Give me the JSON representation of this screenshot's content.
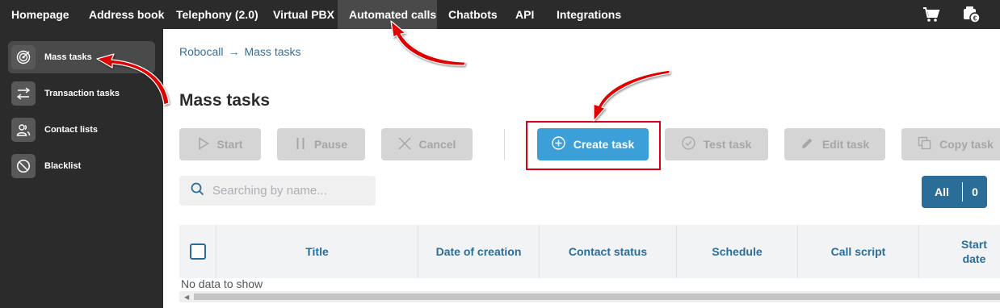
{
  "topnav": {
    "items": [
      {
        "label": "Homepage"
      },
      {
        "label": "Address book"
      },
      {
        "label": "Telephony (2.0)"
      },
      {
        "label": "Virtual PBX"
      },
      {
        "label": "Automated calls",
        "active": true
      },
      {
        "label": "Chatbots"
      },
      {
        "label": "API"
      },
      {
        "label": "Integrations"
      }
    ],
    "icons": [
      "cart-icon",
      "billing-icon"
    ]
  },
  "sidebar": {
    "items": [
      {
        "label": "Mass tasks",
        "icon": "target-icon",
        "active": true
      },
      {
        "label": "Transaction tasks",
        "icon": "swap-arrows-icon"
      },
      {
        "label": "Contact lists",
        "icon": "contacts-icon"
      },
      {
        "label": "Blacklist",
        "icon": "block-icon"
      }
    ]
  },
  "breadcrumb": {
    "parent": "Robocall",
    "separator": "→",
    "current": "Mass tasks"
  },
  "page_title": "Mass tasks",
  "toolbar": {
    "start": "Start",
    "pause": "Pause",
    "cancel": "Cancel",
    "create": "Create task",
    "test": "Test task",
    "edit": "Edit task",
    "copy": "Copy task"
  },
  "search": {
    "placeholder": "Searching by name..."
  },
  "filter": {
    "label": "All",
    "count": "0"
  },
  "table": {
    "columns": [
      "Title",
      "Date of creation",
      "Contact status",
      "Schedule",
      "Call script",
      "Start date"
    ],
    "empty_text": "No data to show"
  },
  "colors": {
    "nav_bg": "#2b2b2b",
    "primary": "#3d9fd8",
    "link": "#2b6d99",
    "annotation": "#d9001b"
  }
}
